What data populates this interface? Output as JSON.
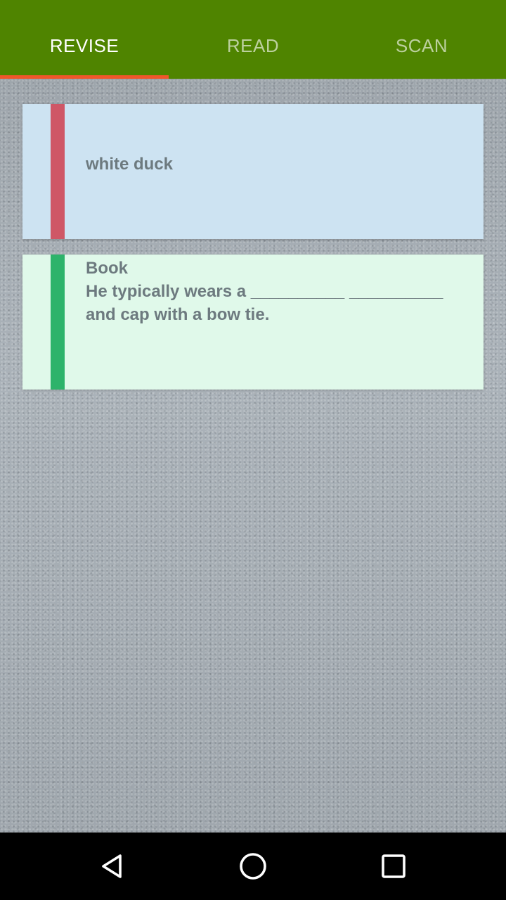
{
  "tabs": [
    {
      "label": "REVISE",
      "active": true
    },
    {
      "label": "READ",
      "active": false
    },
    {
      "label": "SCAN",
      "active": false
    }
  ],
  "colors": {
    "toolbar": "#4f8400",
    "indicator": "#f0572b",
    "card1_bg": "#cde3f2",
    "card1_bar": "#cf5766",
    "card2_bg": "#e0f9ea",
    "card2_bar": "#2db36b"
  },
  "cards": [
    {
      "text": "white duck"
    },
    {
      "text": "Book\nHe typically wears a __________ __________ and cap with a bow tie."
    }
  ],
  "navbar": {
    "back": "back-icon",
    "home": "home-icon",
    "recents": "recents-icon"
  }
}
